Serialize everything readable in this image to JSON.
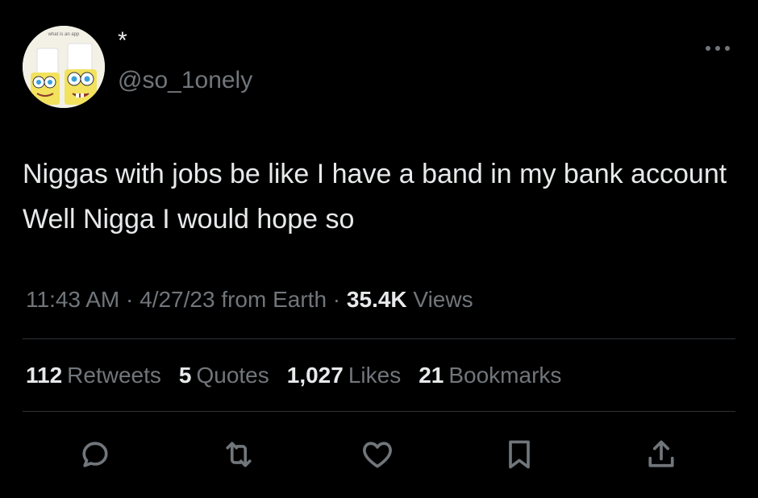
{
  "author": {
    "display_name": "*",
    "handle": "@so_1onely",
    "avatar_caption": "what is an app"
  },
  "tweet": {
    "text": "Niggas with jobs be like I have a band in my bank account Well Nigga I would hope so"
  },
  "meta": {
    "time": "11:43 AM",
    "separator1": " · ",
    "date": "4/27/23",
    "source": " from Earth",
    "separator2": " · ",
    "views_count": "35.4K",
    "views_label": " Views"
  },
  "stats": {
    "retweets": {
      "count": "112",
      "label": "Retweets"
    },
    "quotes": {
      "count": "5",
      "label": "Quotes"
    },
    "likes": {
      "count": "1,027",
      "label": "Likes"
    },
    "bookmarks": {
      "count": "21",
      "label": "Bookmarks"
    }
  },
  "actions": {
    "icons": [
      "reply-icon",
      "retweet-icon",
      "like-icon",
      "bookmark-icon",
      "share-icon"
    ]
  },
  "colors": {
    "background": "#000000",
    "primary_text": "#e7e9ea",
    "secondary_text": "#71767b",
    "divider": "#2f3336"
  }
}
